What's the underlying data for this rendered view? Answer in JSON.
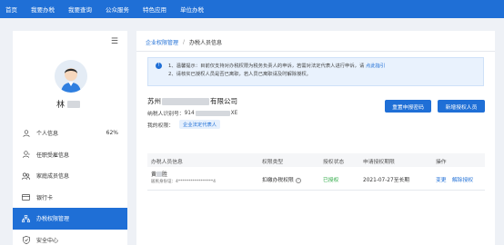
{
  "topnav": {
    "items": [
      "首页",
      "我要办税",
      "我要查询",
      "公众服务",
      "特色应用",
      "单位办税"
    ]
  },
  "sidebar": {
    "user_name": "林",
    "items": [
      {
        "label": "个人信息",
        "extra": "62%",
        "icon": "user-icon"
      },
      {
        "label": "任职受雇信息",
        "extra": "",
        "icon": "user-badge-icon"
      },
      {
        "label": "家庭成员信息",
        "extra": "",
        "icon": "family-icon"
      },
      {
        "label": "银行卡",
        "extra": "",
        "icon": "card-icon"
      },
      {
        "label": "办税权限管理",
        "extra": "",
        "icon": "org-icon",
        "active": true
      },
      {
        "label": "安全中心",
        "extra": "",
        "icon": "shield-icon"
      }
    ]
  },
  "breadcrumb": {
    "root": "企业权限管理",
    "current": "办税人员信息"
  },
  "notice": {
    "line1": "1、温馨提示：目前仅支持对办税权限为税务负责人的申诉，若需对法定代表人进行申诉，请",
    "line1_link": "点此指引",
    "line2": "2、请核实已授权人员是否已离职，若人员已离职请及时解除授权。"
  },
  "company": {
    "name_prefix": "苏州",
    "name_suffix": "有限公司",
    "taxid_label": "纳税人识别号：",
    "taxid_value": "914",
    "taxid_suffix": "XE",
    "role_label": "我的权限：",
    "role_tag": "企业法定代表人"
  },
  "buttons": {
    "reset_password": "重置申报密码",
    "add_authorized": "新增授权人员"
  },
  "table": {
    "headers": [
      "办税人员信息",
      "权限类型",
      "授权状态",
      "申请授权期限",
      "操作"
    ],
    "rows": [
      {
        "name": "黄",
        "name_suffix": "胜",
        "id_text": "居民身份证：4*****************4",
        "permission": "扣缴办税权限",
        "status": "已授权",
        "period": "2021-07-27至长期",
        "op_change": "变更",
        "op_revoke": "解除授权"
      }
    ]
  },
  "colors": {
    "accent": "#1f6fd6",
    "success": "#2eaa46"
  }
}
